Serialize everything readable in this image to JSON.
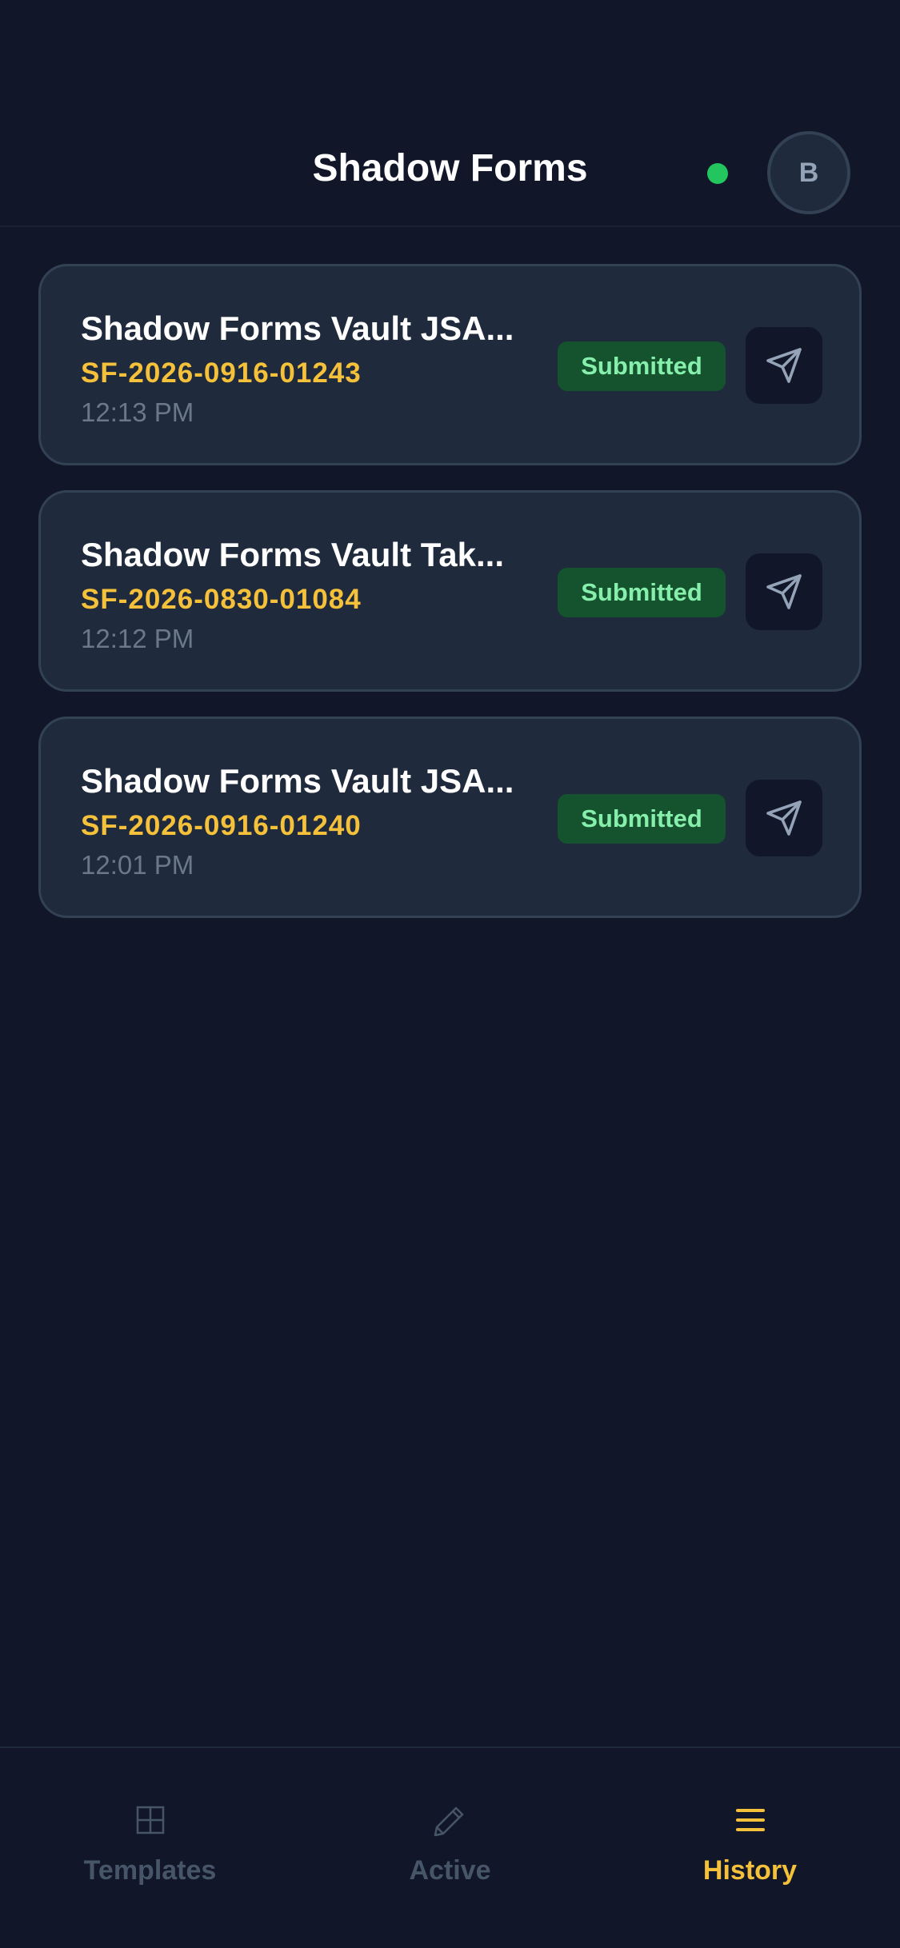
{
  "header": {
    "title": "Shadow Forms",
    "status": "online",
    "avatar_initial": "B"
  },
  "colors": {
    "background": "#111729",
    "card": "#1f2a3c",
    "accent": "#f5c13b",
    "status_green": "#22c55e",
    "badge_bg": "#14532d",
    "badge_text": "#86efac"
  },
  "history": {
    "items": [
      {
        "title": "Shadow Forms Vault JSA...",
        "form_id": "SF-2026-0916-01243",
        "time": "12:13 PM",
        "status": "Submitted",
        "action_icon": "send-icon"
      },
      {
        "title": "Shadow Forms Vault Tak...",
        "form_id": "SF-2026-0830-01084",
        "time": "12:12 PM",
        "status": "Submitted",
        "action_icon": "send-icon"
      },
      {
        "title": "Shadow Forms Vault JSA...",
        "form_id": "SF-2026-0916-01240",
        "time": "12:01 PM",
        "status": "Submitted",
        "action_icon": "send-icon"
      }
    ]
  },
  "bottom_nav": {
    "items": [
      {
        "label": "Templates",
        "icon": "grid-icon",
        "active": false
      },
      {
        "label": "Active",
        "icon": "pencil-icon",
        "active": false
      },
      {
        "label": "History",
        "icon": "list-icon",
        "active": true
      }
    ]
  }
}
